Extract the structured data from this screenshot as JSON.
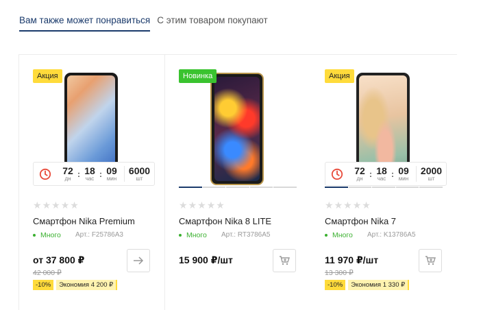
{
  "tabs": [
    {
      "label": "Вам также может понравиться",
      "active": true
    },
    {
      "label": "С этим товаром покупают",
      "active": false
    }
  ],
  "timer_units": {
    "days": "дн",
    "hours": "час",
    "minutes": "мин",
    "pieces": "шт"
  },
  "products": [
    {
      "badge": "Акция",
      "badge_type": "promo",
      "timer": {
        "days": "72",
        "hours": "18",
        "minutes": "09",
        "pieces": "6000"
      },
      "gallery_dots": 0,
      "rating": 0,
      "name": "Смартфон Nika Premium",
      "stock": "Много",
      "sku": "Арт.: F25786A3",
      "price": "от 37 800 ₽",
      "old_price": "42 000 ₽",
      "discount": "-10%",
      "savings": "Экономия 4 200 ₽",
      "action": "arrow-right-icon"
    },
    {
      "badge": "Новинка",
      "badge_type": "new",
      "timer": null,
      "gallery_dots": 5,
      "gallery_active": 0,
      "rating": 0,
      "name": "Смартфон Nika 8 LITE",
      "stock": "Много",
      "sku": "Арт.: RT3786A5",
      "price": "15 900 ₽/шт",
      "old_price": "",
      "discount": "",
      "savings": "",
      "action": "cart-icon"
    },
    {
      "badge": "Акция",
      "badge_type": "promo",
      "timer": {
        "days": "72",
        "hours": "18",
        "minutes": "09",
        "pieces": "2000"
      },
      "gallery_dots": 5,
      "gallery_active": 0,
      "rating": 0,
      "name": "Смартфон Nika 7",
      "stock": "Много",
      "sku": "Арт.: K13786A5",
      "price": "11 970 ₽/шт",
      "old_price": "13 300 ₽",
      "discount": "-10%",
      "savings": "Экономия 1 330 ₽",
      "action": "cart-icon"
    }
  ],
  "colors": {
    "accent": "#1a3a6b",
    "promo": "#ffdb3b",
    "new": "#3ac32f",
    "stock": "#3ab02f",
    "timer_icon": "#e84a3a"
  }
}
